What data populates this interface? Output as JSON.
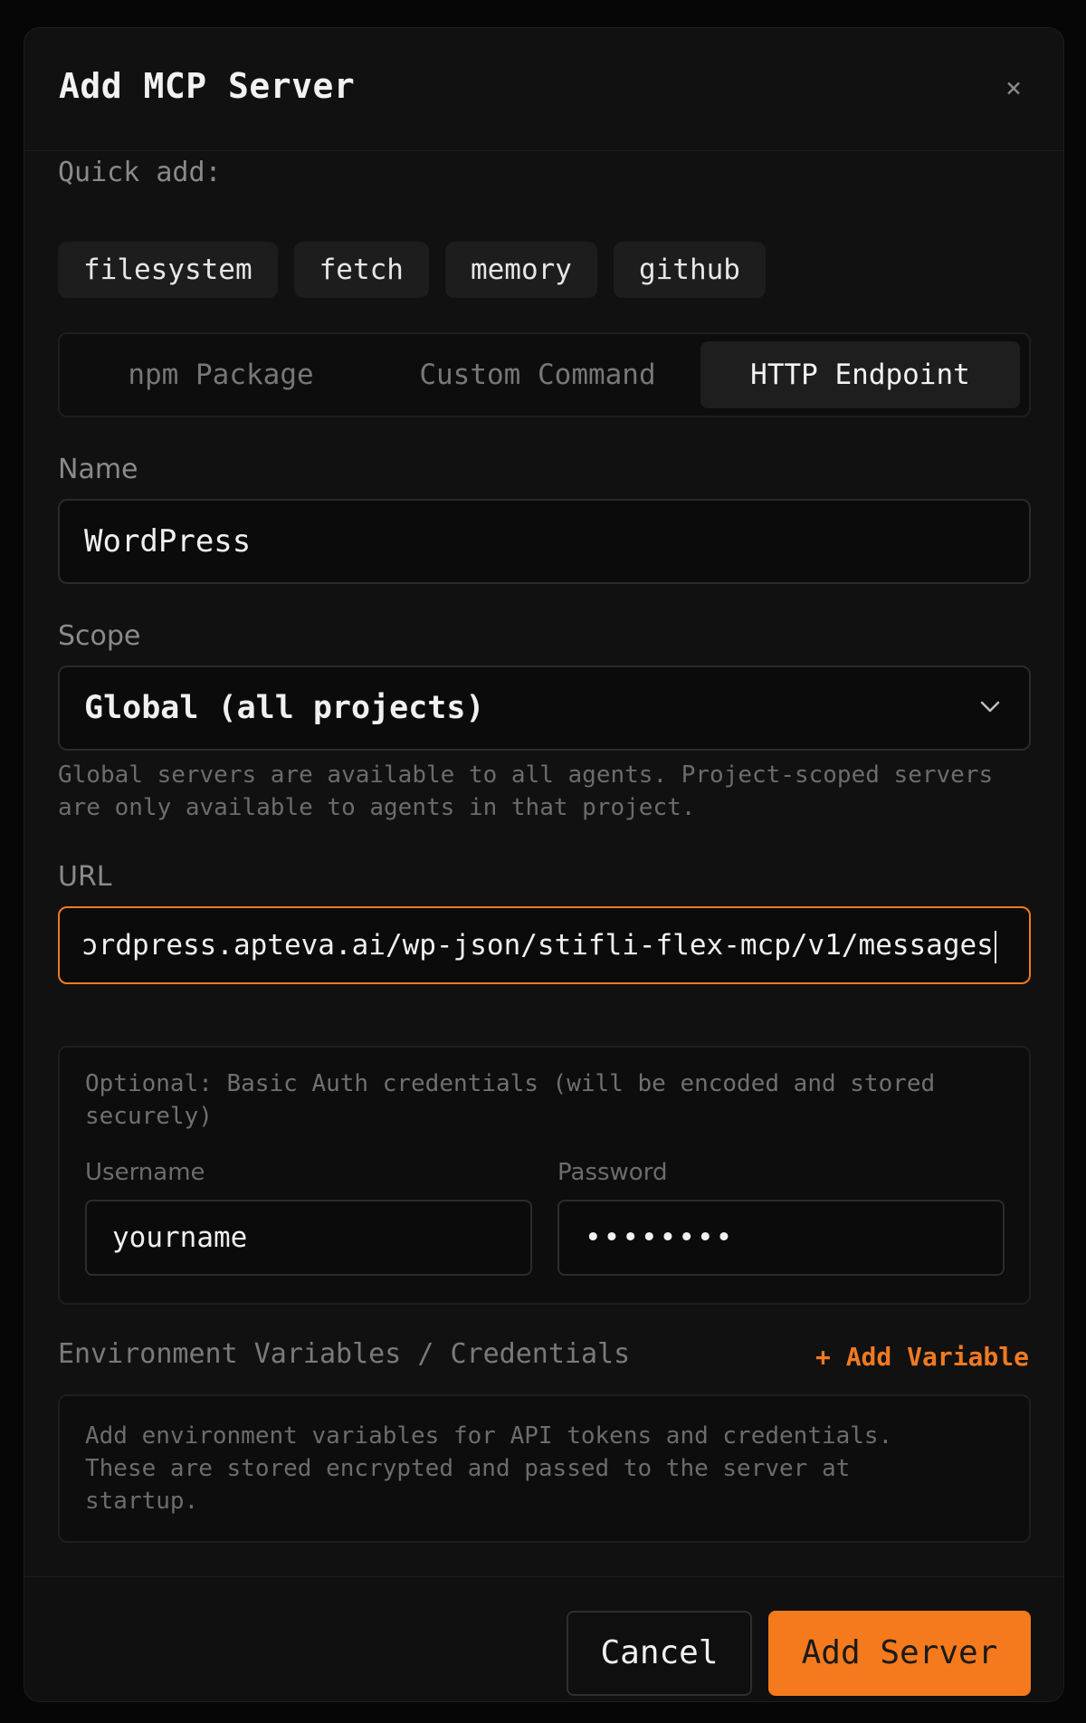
{
  "modal": {
    "title": "Add MCP Server",
    "close_icon": "close-icon"
  },
  "quick_add": {
    "label": "Quick add:",
    "chips": [
      "filesystem",
      "fetch",
      "memory",
      "github"
    ]
  },
  "tabs": [
    {
      "label": "npm Package",
      "active": false
    },
    {
      "label": "Custom Command",
      "active": false
    },
    {
      "label": "HTTP Endpoint",
      "active": true
    }
  ],
  "name_field": {
    "label": "Name",
    "value": "WordPress"
  },
  "scope_field": {
    "label": "Scope",
    "value": "Global (all projects)",
    "help_line1": "Global servers are available to all agents. Project-scoped servers",
    "help_line2": "are only available to agents in that project."
  },
  "url_field": {
    "label": "URL",
    "value": "ɔrdpress.apteva.ai/wp-json/stifli-flex-mcp/v1/messages"
  },
  "auth": {
    "note_line1": "Optional: Basic Auth credentials (will be encoded and stored",
    "note_line2": "securely)",
    "username_label": "Username",
    "username_value": "yourname",
    "password_label": "Password",
    "password_value": "••••••••"
  },
  "env": {
    "label": "Environment Variables / Credentials",
    "add_label": "+ Add Variable",
    "help_line1": "Add environment variables for API tokens and credentials.",
    "help_line2": "These are stored encrypted and passed to the server at",
    "help_line3": "startup."
  },
  "footer": {
    "cancel_label": "Cancel",
    "submit_label": "Add Server"
  },
  "colors": {
    "accent": "#f57a1d",
    "background": "#111111"
  }
}
